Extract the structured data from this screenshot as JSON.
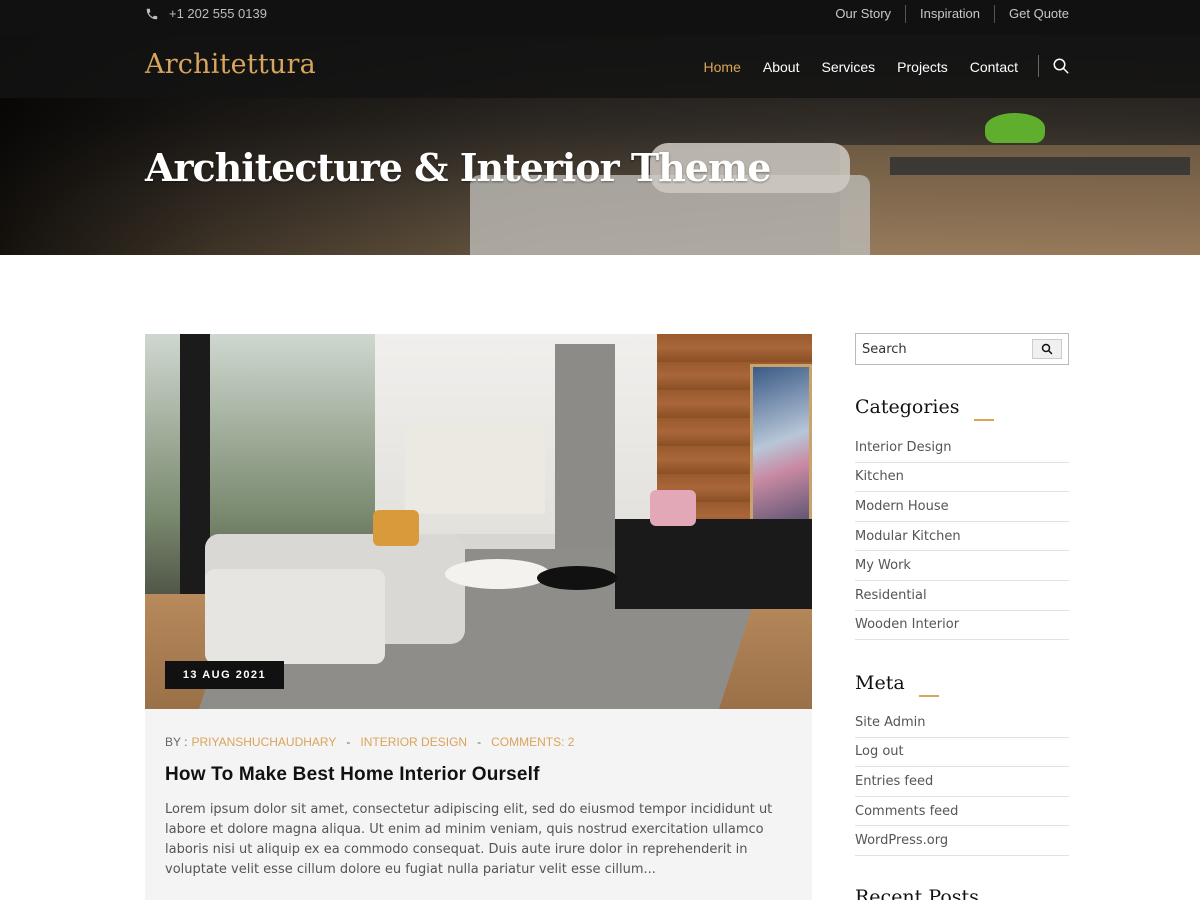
{
  "topbar": {
    "phone": "+1 202 555 0139",
    "links": [
      "Our Story",
      "Inspiration",
      "Get Quote"
    ]
  },
  "nav": {
    "logo": "Architettura",
    "items": [
      "Home",
      "About",
      "Services",
      "Projects",
      "Contact"
    ],
    "active": "Home"
  },
  "hero": {
    "title": "Architecture & Interior Theme"
  },
  "post": {
    "date": "13 AUG 2021",
    "meta": {
      "by_label": "BY :",
      "author": "PRIYANSHUCHAUDHARY",
      "category": "INTERIOR DESIGN",
      "comments": "COMMENTS: 2",
      "separator": "-"
    },
    "title": "How To Make Best Home Interior Ourself",
    "excerpt": "Lorem ipsum dolor sit amet, consectetur adipiscing elit, sed do eiusmod tempor incididunt ut labore et dolore magna aliqua. Ut enim ad minim veniam, quis nostrud exercitation ullamco laboris nisi ut aliquip ex ea commodo consequat. Duis aute irure dolor in reprehenderit in voluptate velit esse cillum dolore eu fugiat nulla pariatur velit esse cillum..."
  },
  "sidebar": {
    "search_placeholder": "Search",
    "categories_title": "Categories",
    "categories": [
      "Interior Design",
      "Kitchen",
      "Modern House",
      "Modular Kitchen",
      "My Work",
      "Residential",
      "Wooden Interior"
    ],
    "meta_title": "Meta",
    "meta_links": [
      "Site Admin",
      "Log out",
      "Entries feed",
      "Comments feed",
      "WordPress.org"
    ],
    "recent_title": "Recent Posts"
  },
  "colors": {
    "accent": "#d9a45b",
    "dark": "#111111"
  }
}
